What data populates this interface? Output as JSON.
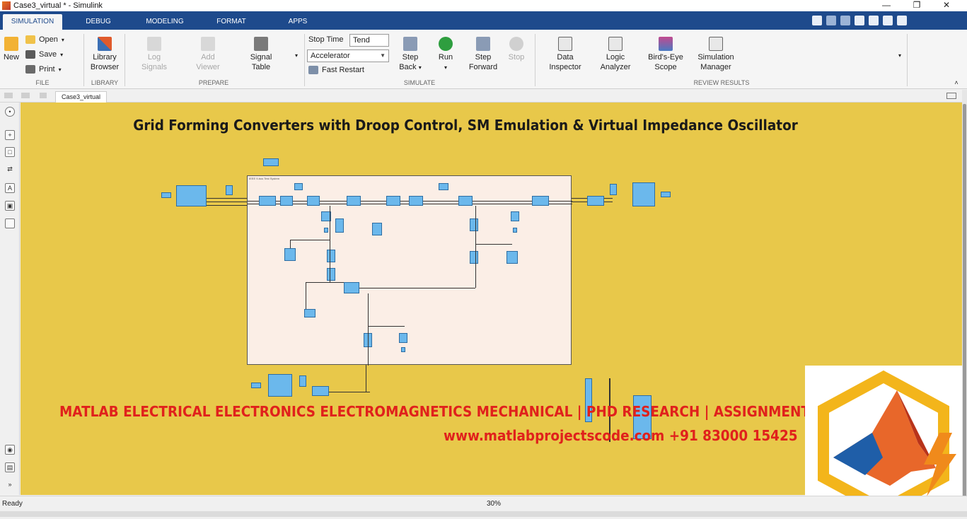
{
  "window": {
    "title": "Case3_virtual * - Simulink"
  },
  "tabs": [
    "SIMULATION",
    "DEBUG",
    "MODELING",
    "FORMAT",
    "APPS"
  ],
  "ribbon": {
    "file": {
      "new_label": "New",
      "open_label": "Open",
      "save_label": "Save",
      "print_label": "Print",
      "group_label": "FILE"
    },
    "library": {
      "browser_line1": "Library",
      "browser_line2": "Browser",
      "group_label": "LIBRARY"
    },
    "prepare": {
      "log_line1": "Log",
      "log_line2": "Signals",
      "add_line1": "Add",
      "add_line2": "Viewer",
      "signal_line1": "Signal",
      "signal_line2": "Table",
      "group_label": "PREPARE"
    },
    "simulate": {
      "stop_time_label": "Stop Time",
      "stop_time_value": "Tend",
      "mode_value": "Accelerator",
      "fast_restart_label": "Fast Restart",
      "step_back_line1": "Step",
      "step_back_line2": "Back",
      "run_label": "Run",
      "step_fwd_line1": "Step",
      "step_fwd_line2": "Forward",
      "stop_label": "Stop",
      "group_label": "SIMULATE"
    },
    "review": {
      "data_line1": "Data",
      "data_line2": "Inspector",
      "logic_line1": "Logic",
      "logic_line2": "Analyzer",
      "birds_line1": "Bird's-Eye",
      "birds_line2": "Scope",
      "simmgr_line1": "Simulation",
      "simmgr_line2": "Manager",
      "group_label": "REVIEW RESULTS"
    }
  },
  "doc_tab": "Case3_virtual",
  "model": {
    "title": "Grid Forming Converters with Droop Control, SM Emulation & Virtual Impedance Oscillator",
    "subsystem_label": "IEEE 9-bus Test System"
  },
  "watermark": {
    "line1": "MATLAB ELECTRICAL ELECTRONICS ELECTROMAGNETICS MECHANICAL | PHD RESEARCH | ASSIGNMENTS",
    "line2": "www.matlabprojectscode.com +91 83000 15425"
  },
  "status": {
    "text": "Ready",
    "zoom": "30%"
  },
  "colors": {
    "canvas": "#e8c84a",
    "tabbar": "#1e4a8c",
    "watermark": "#e0211c",
    "block": "#6bb8ec"
  },
  "icons": [
    "new-icon",
    "open-folder-icon",
    "save-icon",
    "print-icon",
    "library-icon",
    "log-signals-icon",
    "add-viewer-icon",
    "signal-table-icon",
    "step-back-icon",
    "run-icon",
    "step-forward-icon",
    "stop-icon",
    "data-inspector-icon",
    "logic-analyzer-icon",
    "birds-eye-icon",
    "simulation-manager-icon",
    "matlab-logo-icon"
  ]
}
